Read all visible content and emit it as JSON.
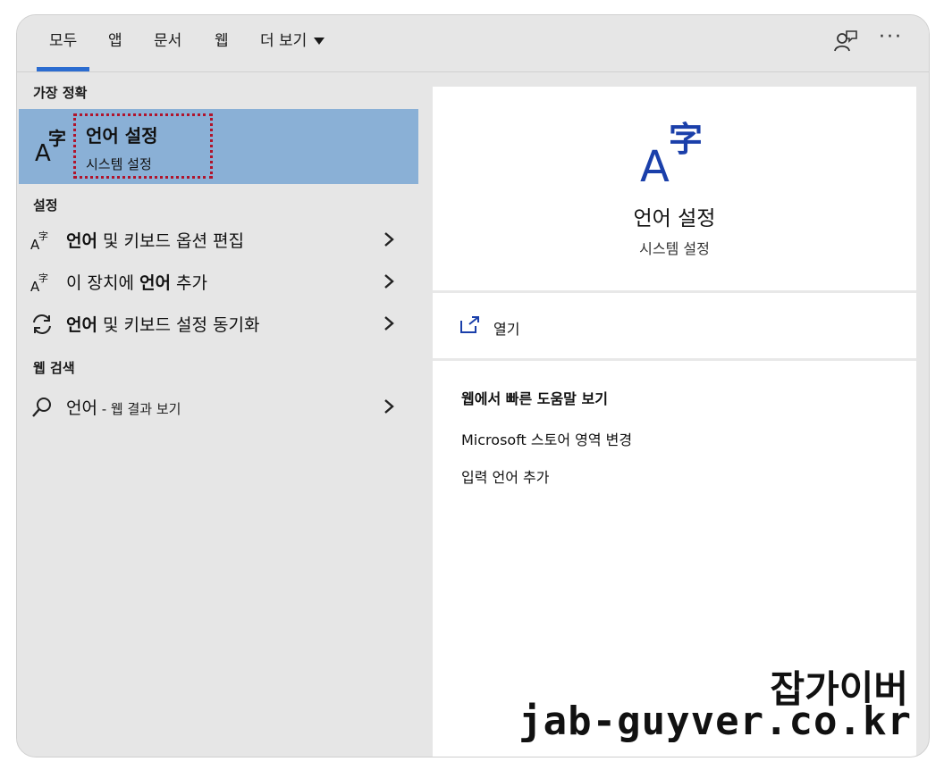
{
  "tabs": [
    {
      "label": "모두",
      "active": true
    },
    {
      "label": "앱"
    },
    {
      "label": "문서"
    },
    {
      "label": "웹"
    },
    {
      "label": "더 보기"
    }
  ],
  "toolbar": {
    "more_label": "···"
  },
  "left": {
    "best_match_title": "가장 정확",
    "best_match": {
      "title": "언어 설정",
      "subtitle": "시스템 설정"
    },
    "settings_title": "설정",
    "settings_items": [
      {
        "prefix": "",
        "bold": "언어",
        "rest": " 및 키보드 옵션 편집"
      },
      {
        "prefix": "이 장치에 ",
        "bold": "언어",
        "rest": " 추가"
      },
      {
        "prefix": "",
        "bold": "언어",
        "rest": " 및 키보드 설정 동기화"
      }
    ],
    "web_title": "웹 검색",
    "web_item": {
      "label": "언어",
      "suffix": " - 웹 결과 보기"
    }
  },
  "right": {
    "title": "언어 설정",
    "subtitle": "시스템 설정",
    "open_label": "열기",
    "web_help_title": "웹에서 빠른 도움말 보기",
    "links": [
      "Microsoft 스토어 영역 변경",
      "입력 언어 추가"
    ]
  },
  "watermark": {
    "line1": "잡가이버",
    "line2": "jab-guyver.co.kr"
  },
  "colors": {
    "accent": "#2b6cd0",
    "selected": "#8ab0d6",
    "icon_blue": "#1a3faa",
    "highlight_border": "#b0142c"
  }
}
